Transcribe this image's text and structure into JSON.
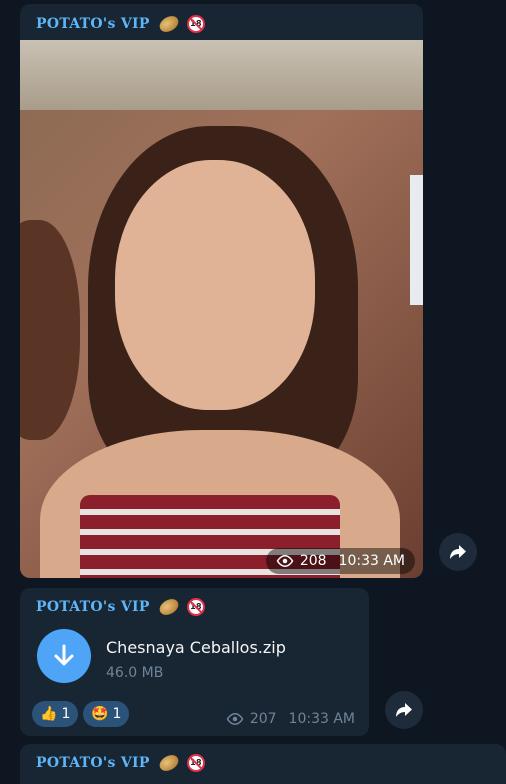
{
  "messages": [
    {
      "sender": "POTATO's VIP",
      "views": "208",
      "time": "10:33 AM"
    },
    {
      "sender": "POTATO's VIP",
      "file_name": "Chesnaya Ceballos.zip",
      "file_size": "46.0 MB",
      "reactions": [
        {
          "emoji": "👍",
          "count": "1"
        },
        {
          "emoji": "🤩",
          "count": "1"
        }
      ],
      "views": "207",
      "time": "10:33 AM"
    },
    {
      "sender": "POTATO's VIP"
    }
  ],
  "colors": {
    "background": "#0e1621",
    "bubble": "#182533",
    "sender": "#5eb5f7",
    "accent": "#4ea4f6",
    "reaction": "#2b5278",
    "meta": "#708499"
  },
  "icons": [
    "potato-emoji",
    "no-under-18-icon",
    "eye-icon",
    "share-icon",
    "download-arrow-icon"
  ]
}
